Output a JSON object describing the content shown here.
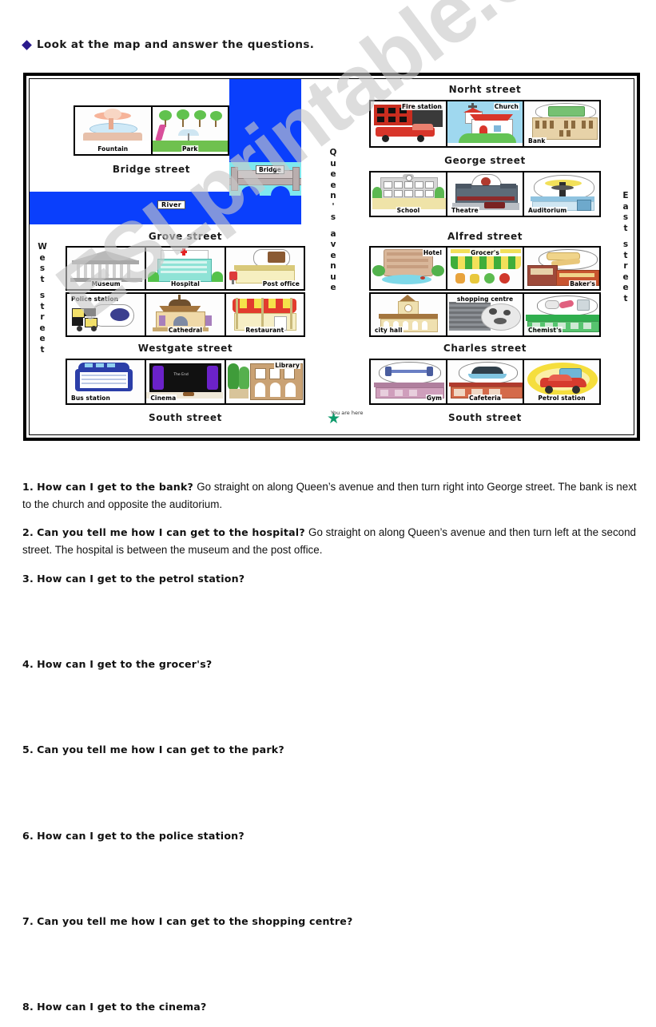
{
  "heading": {
    "bullet": "diamond-bullet",
    "text": "Look at the map and answer the questions."
  },
  "watermark": {
    "text": "ESLprintable.com"
  },
  "map": {
    "water_labels": {
      "river": "River",
      "bridge": "Bridge"
    },
    "you_are_here": {
      "marker": "green-star",
      "label": "You are here"
    },
    "avenue": {
      "name": "Queen's avenue",
      "letters": [
        "Q",
        "u",
        "e",
        "e",
        "n",
        "'",
        "s",
        " ",
        "a",
        "v",
        "e",
        "n",
        "u",
        "e"
      ]
    },
    "west_street": {
      "name": "West street",
      "letters": [
        "W",
        "e",
        "s",
        "t",
        " ",
        "s",
        "t",
        "r",
        "e",
        "e",
        "t"
      ]
    },
    "east_street": {
      "name": "East street",
      "letters": [
        "E",
        "a",
        "s",
        "t",
        " ",
        "s",
        "t",
        "r",
        "e",
        "e",
        "t"
      ]
    },
    "streets": {
      "north": "Norht street",
      "george": "George street",
      "alfred": "Alfred street",
      "charles": "Charles street",
      "bridge": "Bridge street",
      "grove": "Grove street",
      "westgate": "Westgate street",
      "south_left": "South street",
      "south_right": "South street"
    },
    "buildings": {
      "bridge_row": [
        "Fountain",
        "Park"
      ],
      "north_row": [
        "Fire station",
        "Church",
        "Bank"
      ],
      "george_row": [
        "School",
        "Theatre",
        "Auditorium"
      ],
      "grove_row": [
        "Museum",
        "Hospital",
        "Post office"
      ],
      "westgate_row": [
        "Police station",
        "Cathedral",
        "Restaurant"
      ],
      "alfred_row": [
        "Hotel",
        "Grocer's",
        "Baker's"
      ],
      "charles_row": [
        "city hall",
        "shopping centre",
        "Chemist's"
      ],
      "south_left_row": [
        "Bus station",
        "Cinema",
        "Library"
      ],
      "south_right_row": [
        "Gym",
        "Cafeteria",
        "Petrol station"
      ]
    },
    "cinema_screen_text": "The End"
  },
  "questions": [
    {
      "number": "1.",
      "text": "How can I get to the bank?",
      "answer": "Go straight on along Queen’s avenue and then turn right into George street. The bank is next to the church and opposite the auditorium.",
      "blank": false
    },
    {
      "number": "2.",
      "text": "Can you tell me how I can get to the hospital?",
      "answer": "Go straight on along Queen’s avenue and then turn left at the second street. The hospital is between the museum and the post office.",
      "blank": false
    },
    {
      "number": "3.",
      "text": "How can I get to the petrol station?",
      "answer": "",
      "blank": true
    },
    {
      "number": "4.",
      "text": "How can I get to the grocer's?",
      "answer": "",
      "blank": true
    },
    {
      "number": "5.",
      "text": "Can you tell me how I can get to the park?",
      "answer": "",
      "blank": true
    },
    {
      "number": "6.",
      "text": "How can I get to the police station?",
      "answer": "",
      "blank": true
    },
    {
      "number": "7.",
      "text": "Can you tell me how I can get to the shopping centre?",
      "answer": "",
      "blank": true
    },
    {
      "number": "8.",
      "text": "How can I get to the cinema?",
      "answer": "",
      "blank": true
    }
  ],
  "colors": {
    "water": "#0a3ffc",
    "bullet": "#2a1a8c",
    "star": "#0f9b6c",
    "watermark": "#c9c9c9"
  }
}
